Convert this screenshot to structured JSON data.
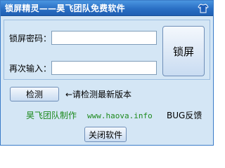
{
  "window": {
    "title": "锁屏精灵——昊飞团队免费软件",
    "title_icon": "shirt-icon"
  },
  "form": {
    "password_label": "锁屏密码：",
    "password_value": "",
    "confirm_label": "再次输入：",
    "confirm_value": "",
    "lock_button": "锁屏"
  },
  "check": {
    "button": "检测",
    "hint": "←请检测最新版本"
  },
  "footer": {
    "credit": "昊飞团队制作",
    "website": "www.haova.info",
    "feedback": "BUG反馈",
    "close_button": "关闭软件"
  },
  "colors": {
    "title_bar": "#2a6fc4",
    "window_bg": "#d4e6f5",
    "credit_text": "#1e8a1e"
  }
}
